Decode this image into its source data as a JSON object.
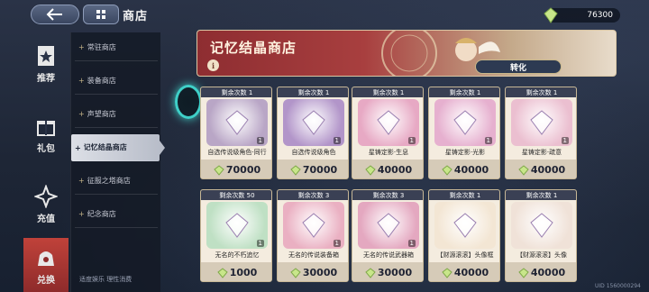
{
  "header": {
    "title": "商店",
    "currency_amount": "76300"
  },
  "nav": [
    {
      "label": "推荐",
      "icon": "star-badge-icon"
    },
    {
      "label": "礼包",
      "icon": "gift-icon"
    },
    {
      "label": "充值",
      "icon": "sparkle-star-icon"
    },
    {
      "label": "兑换",
      "icon": "exchange-bag-icon"
    }
  ],
  "subnav": [
    "常驻商店",
    "装备商店",
    "声望商店",
    "记忆结晶商店",
    "征服之塔商店",
    "纪念商店"
  ],
  "footer_note": "适度娱乐 理性消费",
  "banner": {
    "title": "记忆结晶商店",
    "info": "i",
    "convert_label": "转化"
  },
  "items": [
    {
      "remain": "剩余次数 1",
      "qty": "1",
      "name": "自选传说级角色·同行",
      "price": "70000",
      "art": "#b9a6c6"
    },
    {
      "remain": "剩余次数 1",
      "qty": "1",
      "name": "自选传说级角色",
      "price": "70000",
      "art": "#b295c9"
    },
    {
      "remain": "剩余次数 1",
      "qty": "1",
      "name": "星铸定影·生息",
      "price": "40000",
      "art": "#e7a9c4"
    },
    {
      "remain": "剩余次数 1",
      "qty": "1",
      "name": "星铸定影·光影",
      "price": "40000",
      "art": "#e6b0cf"
    },
    {
      "remain": "剩余次数 1",
      "qty": "1",
      "name": "星铸定影·疏意",
      "price": "40000",
      "art": "#ebbfd0"
    },
    {
      "remain": "剩余次数 50",
      "qty": "1",
      "name": "无名的不朽追忆",
      "price": "1000",
      "art": "#bfe0c4"
    },
    {
      "remain": "剩余次数 3",
      "qty": "1",
      "name": "无名的传说装备箱",
      "price": "30000",
      "art": "#eab0c2"
    },
    {
      "remain": "剩余次数 3",
      "qty": "1",
      "name": "无名的传说武器箱",
      "price": "30000",
      "art": "#e4a8c0"
    },
    {
      "remain": "剩余次数 1",
      "qty": "",
      "name": "【财源滚滚】头像框",
      "price": "40000",
      "art": "#f3e6d4"
    },
    {
      "remain": "剩余次数 1",
      "qty": "",
      "name": "【财源滚滚】头像",
      "price": "40000",
      "art": "#f0e2d8"
    }
  ],
  "uid": "UID 1560000294"
}
